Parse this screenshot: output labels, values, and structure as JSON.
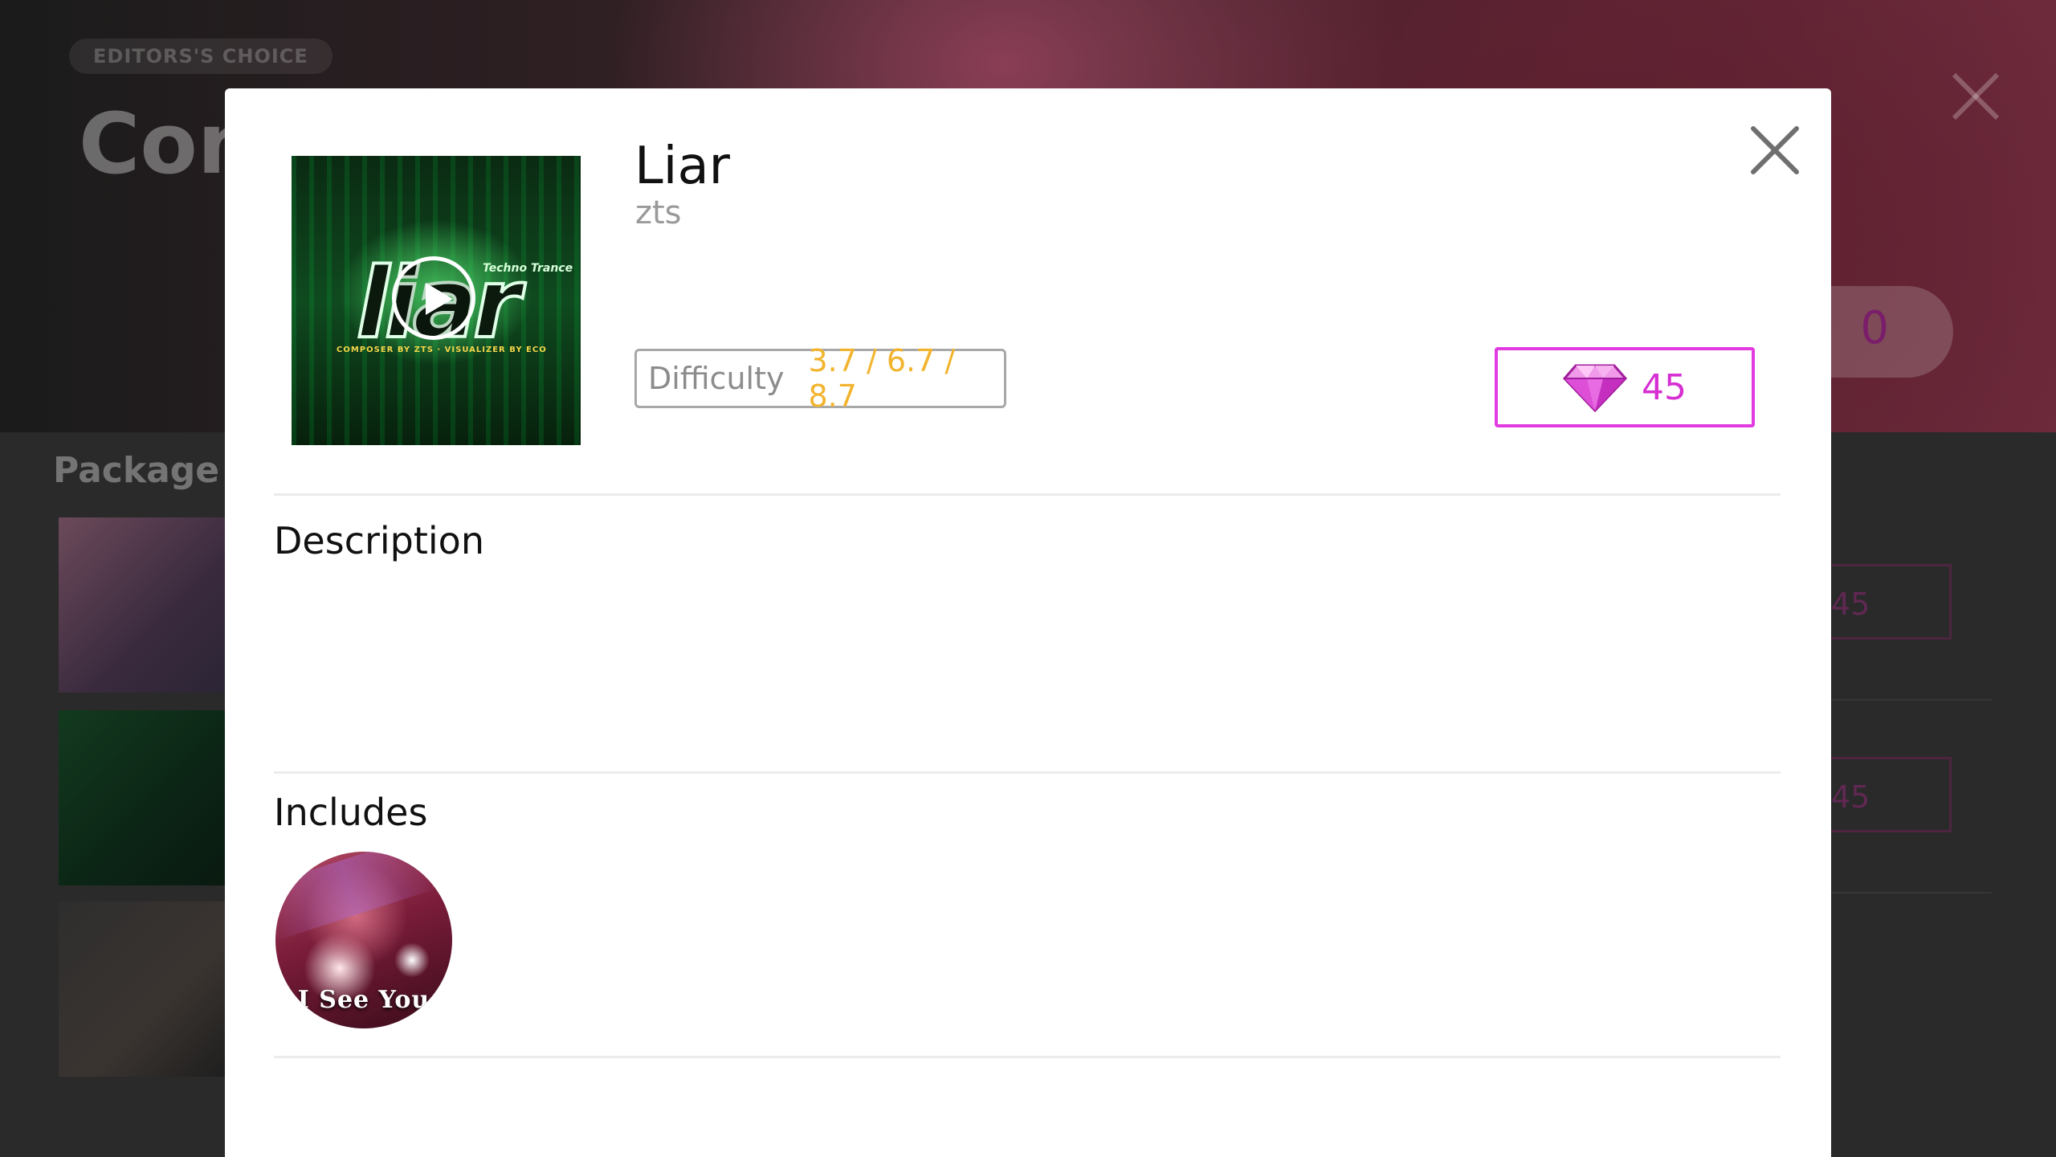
{
  "background": {
    "badge": "EDITORS'S CHOICE",
    "title_partial": "Con",
    "section_title_partial": "Package li",
    "price_partial": "0",
    "row_prices": [
      "45",
      "45"
    ]
  },
  "modal": {
    "cover": {
      "logo_text": "liar",
      "genre_tag": "Techno Trance",
      "credits": "COMPOSER BY ZTS · VISUALIZER BY ECO",
      "play_icon": "play-icon"
    },
    "title": "Liar",
    "artist": "zts",
    "difficulty": {
      "label": "Difficulty",
      "values": "3.7 / 6.7 / 8.7"
    },
    "price": {
      "icon": "gem-icon",
      "amount": "45"
    },
    "description": {
      "heading": "Description",
      "text": ""
    },
    "includes": {
      "heading": "Includes",
      "items": [
        {
          "label": "I See You"
        }
      ]
    },
    "close_icon": "close-icon"
  },
  "colors": {
    "price_accent": "#e23ce0",
    "difficulty_values": "#f2b42e",
    "artist_gray": "#9a9a9a"
  }
}
